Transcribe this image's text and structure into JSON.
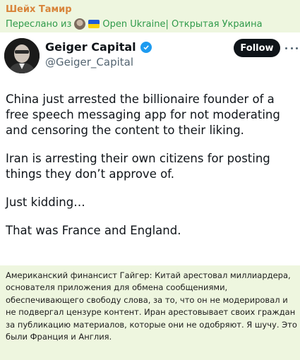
{
  "message": {
    "sender": "Шейх Тамир",
    "forwarded_prefix": "Переслано из",
    "forwarded_channel": "Open Ukraine| Открытая Украина"
  },
  "tweet": {
    "author_name": "Geiger Capital",
    "handle": "@Geiger_Capital",
    "follow_label": "Follow",
    "paragraphs": [
      "China just arrested the billionaire founder of a free speech messaging app for not moderating and censoring the content to their liking.",
      "Iran is arresting their own citizens for posting things they don’t approve of.",
      "Just kidding…",
      "That was France and England."
    ]
  },
  "caption": "Американский финансист Гайгер: Китай арестовал миллиардера, основателя приложения для обмена сообщениями, обеспечивающего свободу слова, за то, что он не модерировал и не подвергал цензуре контент. Иран арестовывает своих граждан за публикацию материалов, которые они не одобряют. Я шучу. Это были Франция и Англия.",
  "icons": {
    "verified": "verified-badge-icon",
    "more": "more-options-icon",
    "flag": "ukraine-flag-icon"
  },
  "colors": {
    "sender": "#d8843a",
    "forwarded": "#2f9a4a",
    "bubble_bg": "#eef6df",
    "follow_bg": "#0f1419",
    "verified": "#1d9bf0"
  }
}
